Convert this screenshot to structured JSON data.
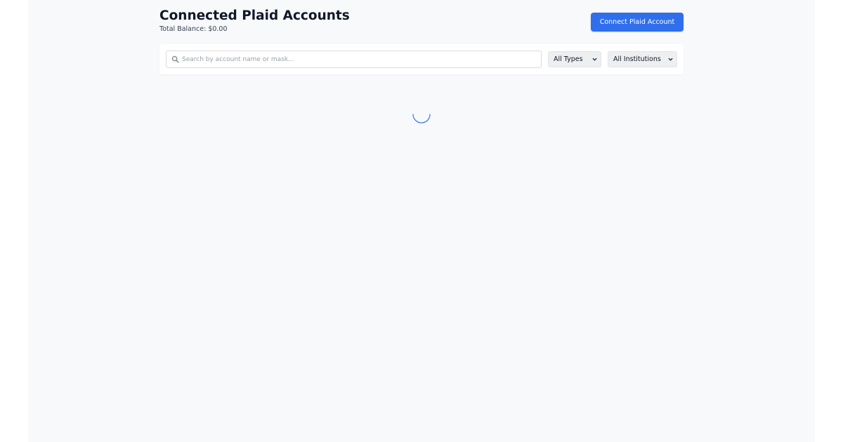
{
  "header": {
    "title": "Connected Plaid Accounts",
    "total_balance": "Total Balance: $0.00",
    "connect_button_label": "Connect Plaid Account"
  },
  "filters": {
    "search_placeholder": "Search by account name or mask...",
    "search_value": "",
    "type_selected": "All Types",
    "institution_selected": "All Institutions"
  },
  "icons": {
    "search": "search-icon",
    "dropdown": "chevron-down-icon",
    "loading": "loading-spinner-icon"
  },
  "colors": {
    "accent": "#2f6fec",
    "background": "#f8f9fb",
    "title_text": "#111827"
  }
}
